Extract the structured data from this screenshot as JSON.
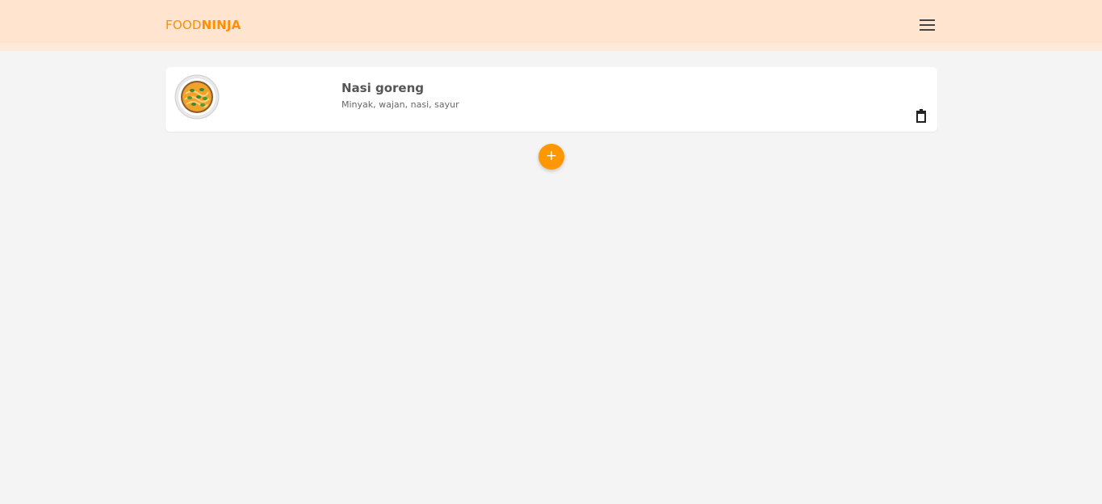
{
  "navbar": {
    "brand_part1": "FOOD",
    "brand_part2": "NINJA",
    "menu_icon": "hamburger-menu-icon",
    "accent_color": "#ff8f00",
    "background_color": "#ffe5cf"
  },
  "recipes": [
    {
      "title": "Nasi goreng",
      "ingredients": "Minyak, wajan, nasi, sayur",
      "image_icon": "noodle-bowl-icon",
      "delete_icon": "trash-icon"
    }
  ],
  "add_button": {
    "label": "+",
    "color": "#ff9800"
  }
}
